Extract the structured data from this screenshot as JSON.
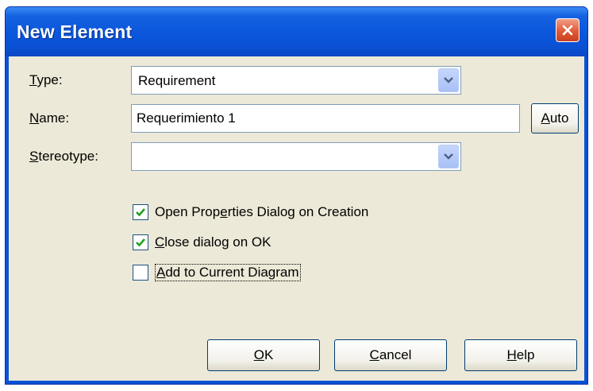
{
  "dialog": {
    "title": "New Element",
    "fields": {
      "type": {
        "label_access": "T",
        "label_rest": "ype:",
        "value": "Requirement"
      },
      "name": {
        "label_access": "N",
        "label_rest": "ame:",
        "value": "Requerimiento 1"
      },
      "stereotype": {
        "label_access": "S",
        "label_rest": "tereotype:",
        "value": ""
      }
    },
    "auto_button": {
      "access": "A",
      "rest": "uto"
    },
    "checkboxes": [
      {
        "pre": "Open Prop",
        "access": "e",
        "post": "rties Dialog on Creation",
        "checked": true
      },
      {
        "pre": "",
        "access": "C",
        "post": "lose dialog on OK",
        "checked": true
      },
      {
        "pre": "",
        "access": "A",
        "post": "dd to Current Diagram",
        "checked": false
      }
    ],
    "buttons": {
      "ok": {
        "access": "O",
        "rest": "K"
      },
      "cancel": {
        "access": "C",
        "rest": "ancel"
      },
      "help": {
        "access": "H",
        "rest": "elp"
      }
    },
    "icons": {
      "close": "close-icon",
      "dropdown": "chevron-down-icon",
      "check": "checkmark-icon"
    },
    "colors": {
      "title_bar": "#0a56dc",
      "client_bg": "#ece9d8",
      "close_button": "#e05a38",
      "check_mark": "#21a121"
    }
  }
}
